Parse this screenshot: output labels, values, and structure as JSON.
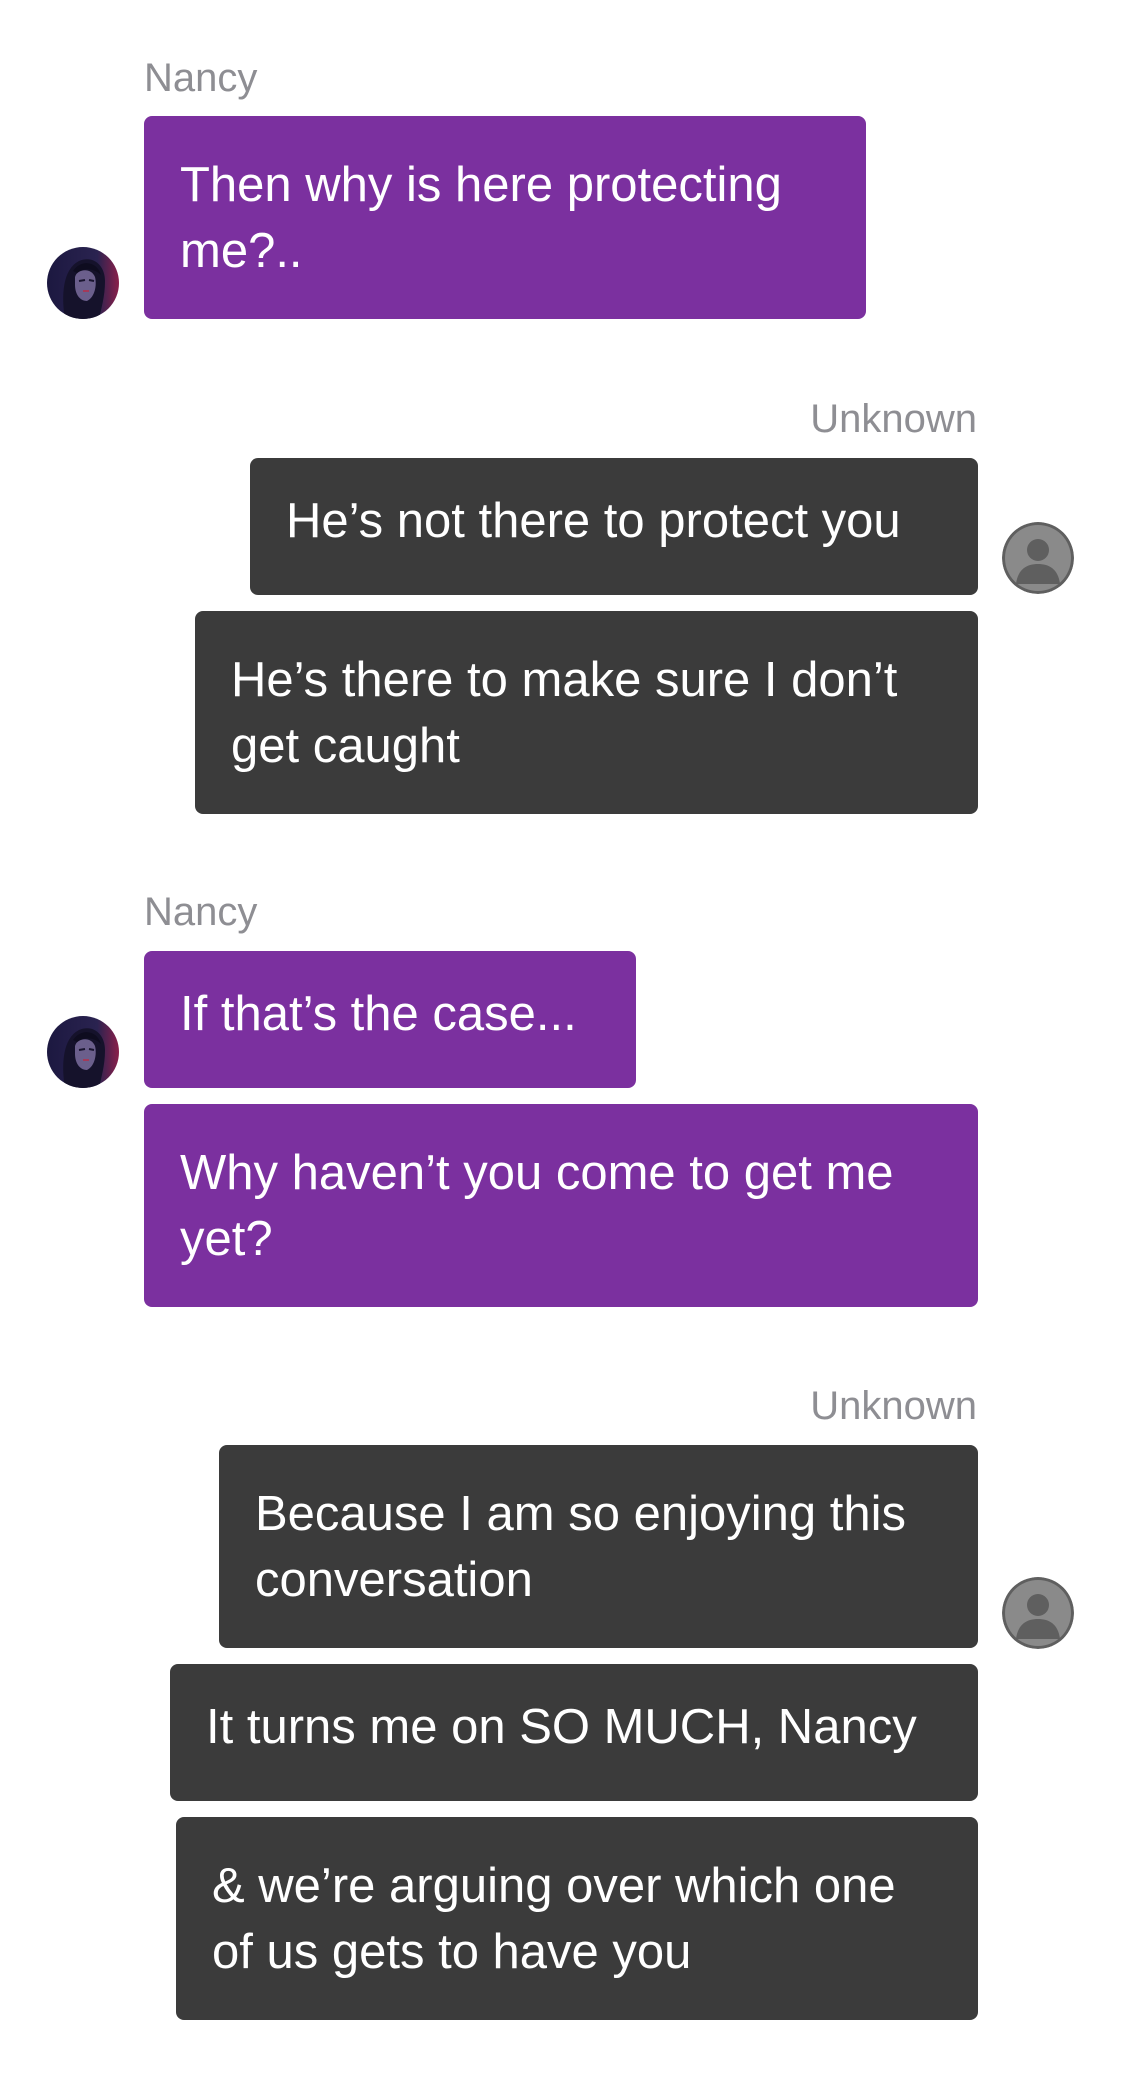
{
  "conversation": {
    "groups": [
      {
        "sender": "Nancy",
        "side": "left",
        "avatar": "nancy-portrait-icon",
        "messages": [
          "Then why is here protecting me?.."
        ]
      },
      {
        "sender": "Unknown",
        "side": "right",
        "avatar": "default-user-silhouette-icon",
        "messages": [
          "He’s not there to protect you",
          "He’s there to make sure I don’t get caught"
        ]
      },
      {
        "sender": "Nancy",
        "side": "left",
        "avatar": "nancy-portrait-icon",
        "messages": [
          "If that’s the case...",
          "Why haven’t you come to get me yet?"
        ]
      },
      {
        "sender": "Unknown",
        "side": "right",
        "avatar": "default-user-silhouette-icon",
        "messages": [
          "Because I am so enjoying this conversation",
          "It turns me on SO MUCH, Nancy",
          "& we’re arguing over which one of us gets to have you"
        ]
      }
    ]
  },
  "colors": {
    "nancy_bubble": "#7b309f",
    "unknown_bubble": "#3b3b3b",
    "sender_name": "#8e8e93",
    "background": "#ffffff",
    "message_text": "#ffffff"
  }
}
